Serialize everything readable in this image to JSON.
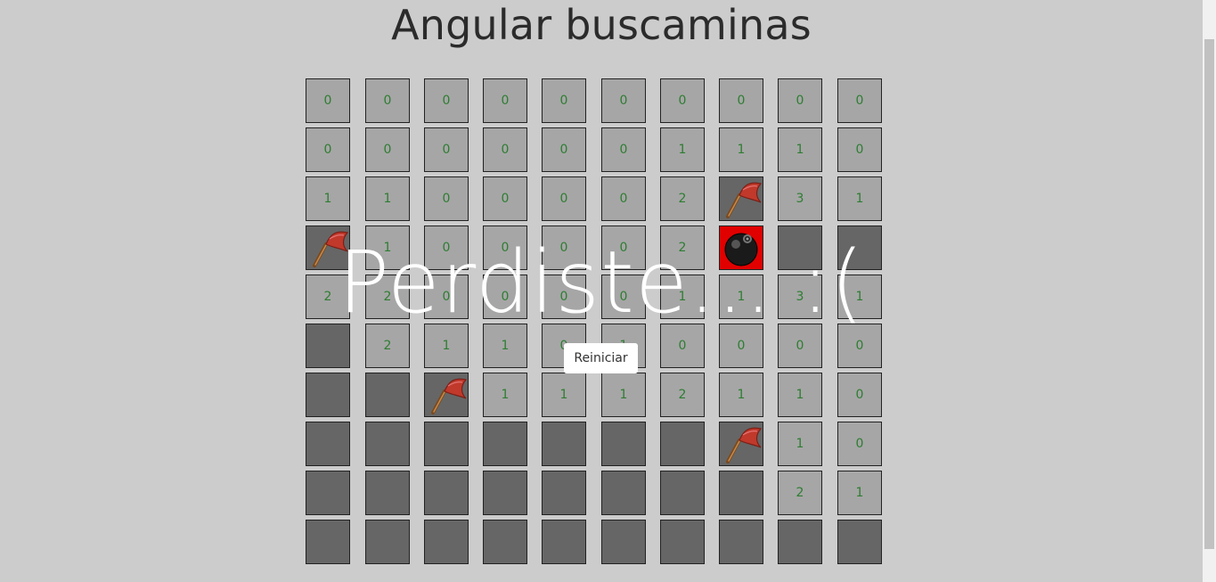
{
  "page": {
    "title": "Angular buscaminas",
    "lose_message": "Perdiste... :(",
    "restart_label": "Reiniciar"
  },
  "colors": {
    "background": "#cccccc",
    "open_cell": "#a6a6a6",
    "closed_cell": "#666666",
    "number_text": "#2e7d32",
    "bomb_cell": "#e00000"
  },
  "board": {
    "rows": [
      [
        "0",
        "0",
        "0",
        "0",
        "0",
        "0",
        "0",
        "0",
        "0",
        "0"
      ],
      [
        "0",
        "0",
        "0",
        "0",
        "0",
        "0",
        "1",
        "1",
        "1",
        "0"
      ],
      [
        "1",
        "1",
        "0",
        "0",
        "0",
        "0",
        "2",
        "F",
        "3",
        "1"
      ],
      [
        "F",
        "1",
        "0",
        "0",
        "0",
        "0",
        "2",
        "B",
        "C",
        "C"
      ],
      [
        "2",
        "2",
        "0",
        "0",
        "0",
        "0",
        "1",
        "1",
        "3",
        "1"
      ],
      [
        "C",
        "2",
        "1",
        "1",
        "0",
        "1",
        "0",
        "0",
        "0",
        "0"
      ],
      [
        "C",
        "C",
        "F",
        "1",
        "1",
        "1",
        "2",
        "1",
        "1",
        "0"
      ],
      [
        "C",
        "C",
        "C",
        "C",
        "C",
        "C",
        "C",
        "F",
        "1",
        "0"
      ],
      [
        "C",
        "C",
        "C",
        "C",
        "C",
        "C",
        "C",
        "C",
        "2",
        "1"
      ],
      [
        "C",
        "C",
        "C",
        "C",
        "C",
        "C",
        "C",
        "C",
        "C",
        "C"
      ]
    ],
    "legend": {
      "F": "flag-icon",
      "B": "bomb-icon",
      "C": "closed"
    }
  }
}
